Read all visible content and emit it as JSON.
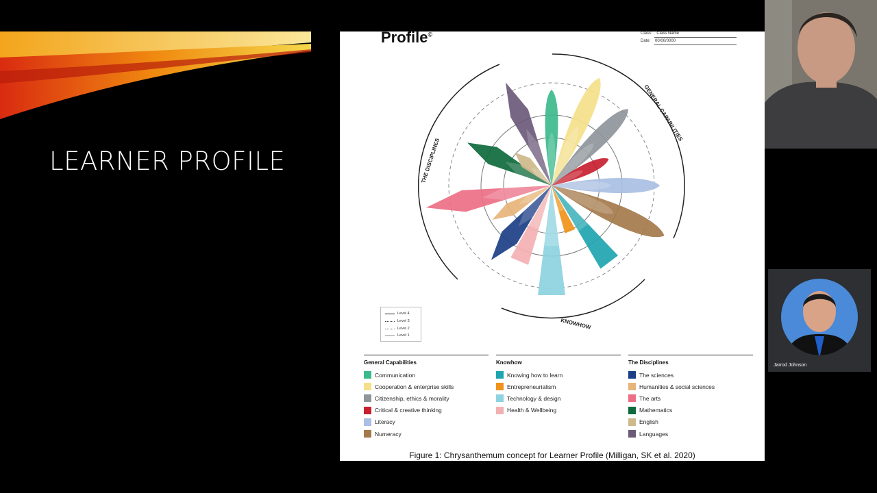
{
  "slide": {
    "title": "LEARNER PROFILE"
  },
  "figure": {
    "header_title": "Profile",
    "header_mark": "©",
    "class_label": "Class:",
    "class_value": "Class Name",
    "date_label": "Date:",
    "date_value": "00/00/0000",
    "arc_labels": {
      "disciplines": "THE DISCIPLINES",
      "general": "GENERAL CAPABILITIES",
      "knowhow": "KNOWHOW"
    },
    "levels": [
      "Level 4",
      "Level 3",
      "Level 2",
      "Level 1"
    ],
    "caption": "Figure 1: Chrysanthemum concept for Learner Profile (Milligan, SK et al. 2020)"
  },
  "legend": {
    "general": {
      "heading": "General Capabilities",
      "items": [
        {
          "label": "Communication",
          "color": "#3dba8c"
        },
        {
          "label": "Cooperation & enterprise skills",
          "color": "#f4e08a"
        },
        {
          "label": "Citizenship, ethics & morality",
          "color": "#8e959b"
        },
        {
          "label": "Critical & creative thinking",
          "color": "#c8202f"
        },
        {
          "label": "Literacy",
          "color": "#a9bfe3"
        },
        {
          "label": "Numeracy",
          "color": "#a47a4c"
        }
      ]
    },
    "knowhow": {
      "heading": "Knowhow",
      "items": [
        {
          "label": "Knowing how to learn",
          "color": "#1fa5b0"
        },
        {
          "label": "Entrepreneurialism",
          "color": "#f0921b"
        },
        {
          "label": "Technology & design",
          "color": "#8dd3e0"
        },
        {
          "label": "Health & Wellbeing",
          "color": "#f3b0b2"
        }
      ]
    },
    "disciplines": {
      "heading": "The Disciplines",
      "items": [
        {
          "label": "The sciences",
          "color": "#1c3f87"
        },
        {
          "label": "Humanities & social sciences",
          "color": "#e7b47a"
        },
        {
          "label": "The arts",
          "color": "#ec6f86"
        },
        {
          "label": "Mathematics",
          "color": "#0f6a3c"
        },
        {
          "label": "English",
          "color": "#cdb98a"
        },
        {
          "label": "Languages",
          "color": "#6c5a79"
        }
      ]
    }
  },
  "webcam": {
    "name": "Jarrod Johnson"
  }
}
